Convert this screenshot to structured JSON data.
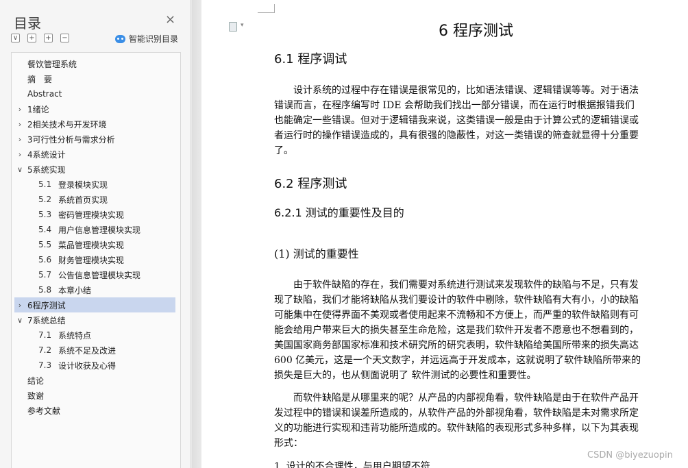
{
  "sidebar": {
    "title": "目录",
    "close_icon": "×",
    "tools": [
      "∨",
      "+",
      "+",
      "−"
    ],
    "smart_label": "智能识别目录",
    "items": [
      {
        "label": "餐饮管理系统",
        "num": "",
        "level": 0,
        "arrow": ""
      },
      {
        "label": "摘　要",
        "num": "",
        "level": 0,
        "arrow": ""
      },
      {
        "label": "Abstract",
        "num": "",
        "level": 0,
        "arrow": ""
      },
      {
        "label": "1绪论",
        "num": "",
        "level": 0,
        "arrow": "›"
      },
      {
        "label": "2相关技术与开发环境",
        "num": "",
        "level": 0,
        "arrow": "›"
      },
      {
        "label": "3可行性分析与需求分析",
        "num": "",
        "level": 0,
        "arrow": "›"
      },
      {
        "label": "4系统设计",
        "num": "",
        "level": 0,
        "arrow": "›"
      },
      {
        "label": "5系统实现",
        "num": "",
        "level": 0,
        "arrow": "∨"
      },
      {
        "label": "登录模块实现",
        "num": "5.1",
        "level": 1,
        "arrow": ""
      },
      {
        "label": "系统首页实现",
        "num": "5.2",
        "level": 1,
        "arrow": ""
      },
      {
        "label": "密码管理模块实现",
        "num": "5.3",
        "level": 1,
        "arrow": ""
      },
      {
        "label": "用户信息管理模块实现",
        "num": "5.4",
        "level": 1,
        "arrow": ""
      },
      {
        "label": "菜品管理模块实现",
        "num": "5.5",
        "level": 1,
        "arrow": ""
      },
      {
        "label": "财务管理模块实现",
        "num": "5.6",
        "level": 1,
        "arrow": ""
      },
      {
        "label": "公告信息管理模块实现",
        "num": "5.7",
        "level": 1,
        "arrow": ""
      },
      {
        "label": "本章小结",
        "num": "5.8",
        "level": 1,
        "arrow": ""
      },
      {
        "label": "6程序测试",
        "num": "",
        "level": 0,
        "arrow": "›",
        "active": true
      },
      {
        "label": "7系统总结",
        "num": "",
        "level": 0,
        "arrow": "∨"
      },
      {
        "label": "系统特点",
        "num": "7.1",
        "level": 1,
        "arrow": ""
      },
      {
        "label": "系统不足及改进",
        "num": "7.2",
        "level": 1,
        "arrow": ""
      },
      {
        "label": "设计收获及心得",
        "num": "7.3",
        "level": 1,
        "arrow": ""
      },
      {
        "label": "结论",
        "num": "",
        "level": 0,
        "arrow": ""
      },
      {
        "label": "致谢",
        "num": "",
        "level": 0,
        "arrow": ""
      },
      {
        "label": "参考文献",
        "num": "",
        "level": 0,
        "arrow": ""
      }
    ]
  },
  "document": {
    "chapter_title": "6  程序测试",
    "h2_1": "6.1    程序调试",
    "p1": [
      "　　设计系统的过程中存在错误是很常见的，比如语法错误、逻辑错误等等。对于语法",
      "错误而言，在程序编写时 IDE 会帮助我们找出一部分错误，而在运行时根据报错我们",
      "也能确定一些错误。但对于逻辑错我来说，这类错误一般是由于计算公式的逻辑错误或",
      "者运行时的操作错误造成的，具有很强的隐蔽性，对这一类错误的筛查就显得十分重要",
      "了。"
    ],
    "h2_2": "6.2    程序测试",
    "h3_1": "6.2.1    测试的重要性及目的",
    "h4_1": "(1)   测试的重要性",
    "p2": [
      "　　由于软件缺陷的存在，我们需要对系统进行测试来发现软件的缺陷与不足，只有发",
      "现了缺陷，我们才能将缺陷从我们要设计的软件中剔除，软件缺陷有大有小，小的缺陷",
      "可能集中在使得界面不美观或者使用起来不流畅和不方便上，而严重的软件缺陷则有可",
      "能会给用户带来巨大的损失甚至生命危险，这是我们软件开发者不愿意也不想看到的，",
      "美国国家商务部国家标准和技术研究所的研究表明，软件缺陷给美国所带来的损失高达",
      "600 亿美元，这是一个天文数字，并远远高于开发成本，这就说明了软件缺陷所带来的",
      "损失是巨大的，也从侧面说明了 软件测试的必要性和重要性。"
    ],
    "p3": [
      "　　而软件缺陷是从哪里来的呢？从产品的内部视角看，软件缺陷是由于在软件产品开",
      "发过程中的错误和误差所造成的，从软件产品的外部视角看，软件缺陷是未对需求所定",
      "义的功能进行实现和违背功能所造成的。软件缺陷的表现形式多种多样，以下为其表现",
      "形式："
    ],
    "p4_partial": "1.   设计的不合理性，与用户期望不符"
  },
  "watermark": "CSDN @biyezuopin",
  "colors": {
    "active_bg": "#c9d6ee",
    "smart_icon": "#3a8ee6"
  }
}
